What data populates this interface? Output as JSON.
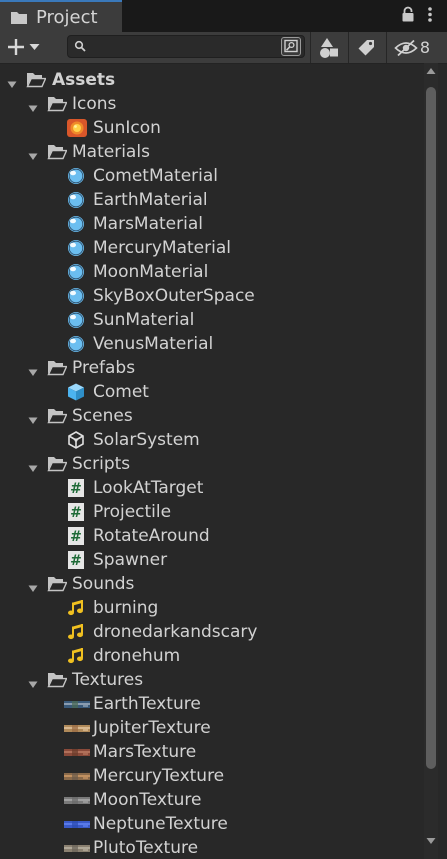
{
  "window": {
    "tab_title": "Project",
    "hidden_count": "8",
    "search": {
      "value": "",
      "placeholder": ""
    }
  },
  "icons": {
    "tab": "folder-icon",
    "lock": "lock-icon",
    "menu": "kebab-menu-icon",
    "create": "plus-icon",
    "search": "search-icon",
    "search_mode": "search-mode-icon",
    "filter_type": "filter-by-type-icon",
    "filter_label": "filter-by-label-icon",
    "hidden": "eye-hidden-icon"
  },
  "colors": {
    "accent": "#3a79bb",
    "material": "#6bbef0",
    "prefab": "#4cb4f0",
    "sound": "#f0c020",
    "script_bg": "#e6e6e6",
    "script_fg": "#1e6a37"
  },
  "tree": {
    "root": {
      "label": "Assets"
    },
    "folders": [
      {
        "name": "Icons",
        "items": [
          {
            "label": "SunIcon",
            "kind": "sunicon"
          }
        ]
      },
      {
        "name": "Materials",
        "items": [
          {
            "label": "CometMaterial",
            "kind": "material"
          },
          {
            "label": "EarthMaterial",
            "kind": "material"
          },
          {
            "label": "MarsMaterial",
            "kind": "material"
          },
          {
            "label": "MercuryMaterial",
            "kind": "material"
          },
          {
            "label": "MoonMaterial",
            "kind": "material"
          },
          {
            "label": "SkyBoxOuterSpace",
            "kind": "material"
          },
          {
            "label": "SunMaterial",
            "kind": "material"
          },
          {
            "label": "VenusMaterial",
            "kind": "material"
          }
        ]
      },
      {
        "name": "Prefabs",
        "items": [
          {
            "label": "Comet",
            "kind": "prefab"
          }
        ]
      },
      {
        "name": "Scenes",
        "items": [
          {
            "label": "SolarSystem",
            "kind": "scene"
          }
        ]
      },
      {
        "name": "Scripts",
        "items": [
          {
            "label": "LookAtTarget",
            "kind": "script"
          },
          {
            "label": "Projectile",
            "kind": "script"
          },
          {
            "label": "RotateAround",
            "kind": "script"
          },
          {
            "label": "Spawner",
            "kind": "script"
          }
        ]
      },
      {
        "name": "Sounds",
        "items": [
          {
            "label": "burning",
            "kind": "sound"
          },
          {
            "label": "dronedarkandscary",
            "kind": "sound"
          },
          {
            "label": "dronehum",
            "kind": "sound"
          }
        ]
      },
      {
        "name": "Textures",
        "items": [
          {
            "label": "EarthTexture",
            "kind": "texture",
            "tint": [
              "#3a5a7a",
              "#8a9cb0",
              "#4a6a52"
            ]
          },
          {
            "label": "JupiterTexture",
            "kind": "texture",
            "tint": [
              "#b08a5a",
              "#d8b890",
              "#9a6a42"
            ]
          },
          {
            "label": "MarsTexture",
            "kind": "texture",
            "tint": [
              "#8a4a3a",
              "#b0705a",
              "#6a3a2a"
            ]
          },
          {
            "label": "MercuryTexture",
            "kind": "texture",
            "tint": [
              "#8a6a4a",
              "#c09060",
              "#6a5a4a"
            ]
          },
          {
            "label": "MoonTexture",
            "kind": "texture",
            "tint": [
              "#7a7a7a",
              "#a0a0a0",
              "#6a6a6a"
            ]
          },
          {
            "label": "NeptuneTexture",
            "kind": "texture",
            "tint": [
              "#3a5ac8",
              "#5a7ae8",
              "#2a4ab0"
            ]
          },
          {
            "label": "PlutoTexture",
            "kind": "texture",
            "tint": [
              "#8a8070",
              "#b0a898",
              "#6a6258"
            ]
          }
        ]
      }
    ]
  }
}
